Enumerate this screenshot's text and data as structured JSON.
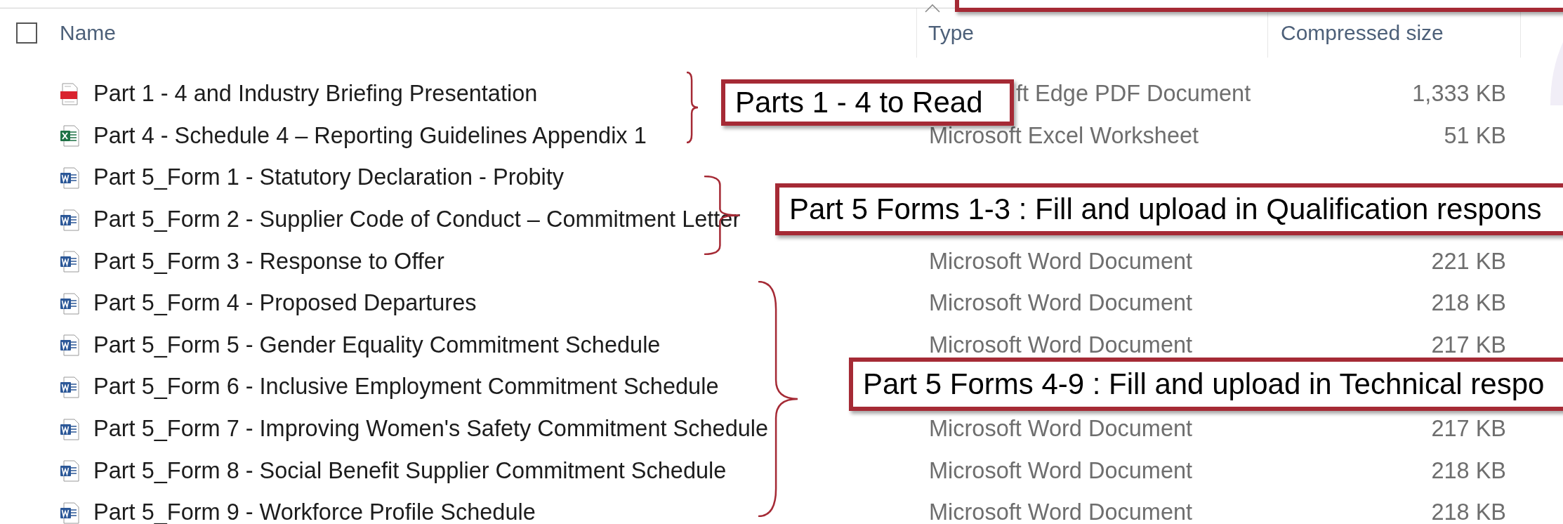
{
  "header": {
    "select_all": {
      "checked": false
    },
    "columns": [
      {
        "label": "Name"
      },
      {
        "label": "Type"
      },
      {
        "label": "Compressed size"
      }
    ]
  },
  "files": [
    {
      "kind": "pdf",
      "name": "Part 1 - 4 and Industry Briefing Presentation",
      "type": "ft Edge PDF Document",
      "size": "1,333 KB"
    },
    {
      "kind": "excel",
      "name": "Part 4 - Schedule 4 – Reporting Guidelines Appendix 1",
      "type": "Microsoft Excel Worksheet",
      "size": "51 KB"
    },
    {
      "kind": "word",
      "name": "Part 5_Form 1 - Statutory Declaration - Probity"
    },
    {
      "kind": "word",
      "name": "Part 5_Form 2 - Supplier Code of Conduct – Commitment Letter"
    },
    {
      "kind": "word",
      "name": "Part 5_Form 3 - Response to Offer",
      "type": "Microsoft Word Document",
      "size": "221 KB"
    },
    {
      "kind": "word",
      "name": "Part 5_Form 4 - Proposed Departures",
      "type": "Microsoft Word Document",
      "size": "218 KB"
    },
    {
      "kind": "word",
      "name": "Part 5_Form 5 - Gender Equality Commitment Schedule",
      "type": "Microsoft Word Document",
      "size": "217 KB"
    },
    {
      "kind": "word",
      "name": "Part 5_Form 6 - Inclusive Employment Commitment Schedule"
    },
    {
      "kind": "word",
      "name": "Part 5_Form 7 - Improving Women's Safety Commitment Schedule",
      "type": "Microsoft Word Document",
      "size": "217 KB"
    },
    {
      "kind": "word",
      "name": "Part 5_Form 8 - Social Benefit Supplier Commitment Schedule",
      "type": "Microsoft Word Document",
      "size": "218 KB"
    },
    {
      "kind": "word",
      "name": "Part 5_Form 9 - Workforce Profile Schedule",
      "type": "Microsoft Word Document",
      "size": "218 KB"
    }
  ],
  "callouts": [
    {
      "text": "Parts 1 - 4 to Read"
    },
    {
      "text": "Part 5 Forms 1-3 : Fill and upload in Qualification respons"
    },
    {
      "text": "Part 5 Forms 4-9 : Fill and upload in Technical respo"
    }
  ]
}
